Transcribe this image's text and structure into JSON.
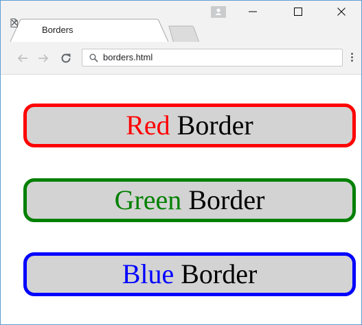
{
  "browser": {
    "tab": {
      "title": "Borders"
    },
    "address_bar": {
      "url": "borders.html"
    }
  },
  "page": {
    "boxes": [
      {
        "color_word": "Red",
        "rest": "Border",
        "color": "#ff0000"
      },
      {
        "color_word": "Green",
        "rest": "Border",
        "color": "#008000"
      },
      {
        "color_word": "Blue",
        "rest": "Border",
        "color": "#0000ff"
      }
    ]
  },
  "colors": {
    "box_background": "#d3d3d3",
    "chrome": "#f2f2f2"
  },
  "icons": [
    "document-icon",
    "close-icon",
    "profile-icon",
    "minimize-icon",
    "maximize-icon",
    "back-icon",
    "forward-icon",
    "reload-icon",
    "search-icon",
    "menu-icon"
  ]
}
